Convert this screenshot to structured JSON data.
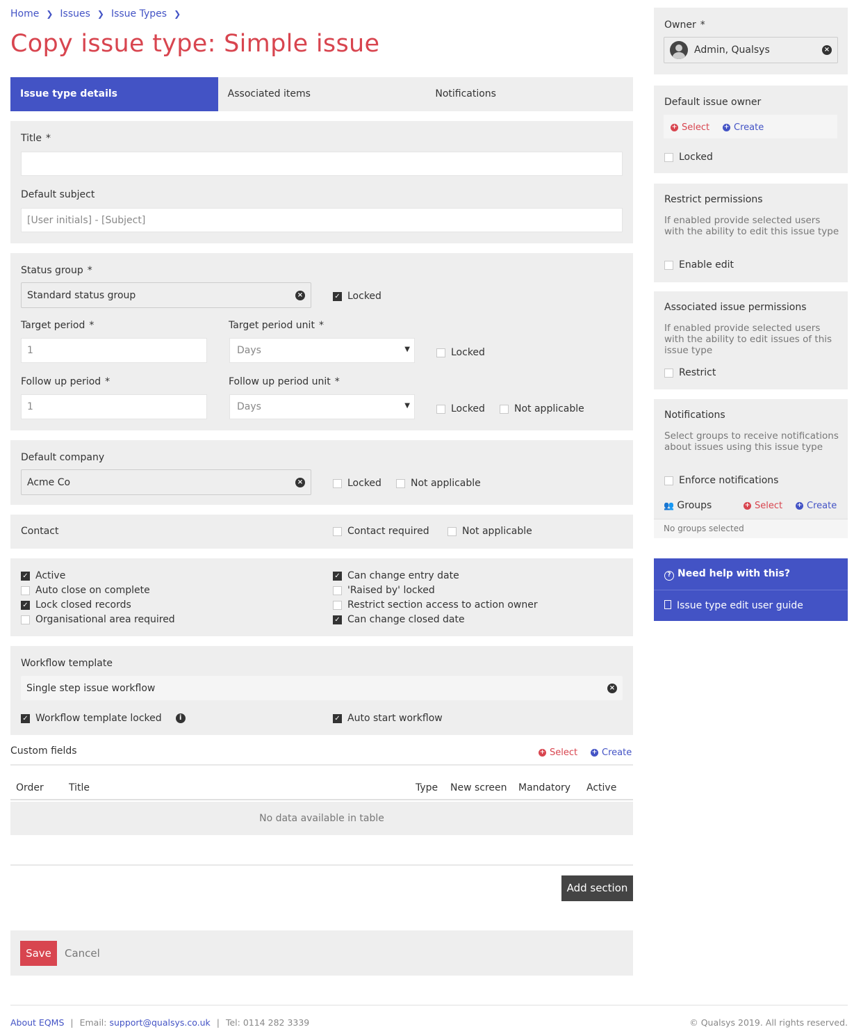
{
  "breadcrumb": [
    "Home",
    "Issues",
    "Issue Types"
  ],
  "page_title": "Copy issue type: Simple issue",
  "tabs": [
    "Issue type details",
    "Associated items",
    "Notifications"
  ],
  "form": {
    "title_label": "Title",
    "title_value": "",
    "default_subject_label": "Default subject",
    "default_subject_placeholder": "[User initials] - [Subject]",
    "status_group_label": "Status group",
    "status_group_value": "Standard status group",
    "status_locked_label": "Locked",
    "target_period_label": "Target period",
    "target_period_value": "1",
    "target_period_unit_label": "Target period unit",
    "target_period_unit_value": "Days",
    "target_locked_label": "Locked",
    "follow_up_period_label": "Follow up period",
    "follow_up_period_value": "1",
    "follow_up_period_unit_label": "Follow up period unit",
    "follow_up_period_unit_value": "Days",
    "follow_locked_label": "Locked",
    "follow_na_label": "Not applicable",
    "default_company_label": "Default company",
    "default_company_value": "Acme Co",
    "company_locked_label": "Locked",
    "company_na_label": "Not applicable",
    "contact_label": "Contact",
    "contact_required_label": "Contact required",
    "contact_na_label": "Not applicable",
    "options_left": [
      {
        "label": "Active",
        "checked": true
      },
      {
        "label": "Auto close on complete",
        "checked": false
      },
      {
        "label": "Lock closed records",
        "checked": true
      },
      {
        "label": "Organisational area required",
        "checked": false
      }
    ],
    "options_right": [
      {
        "label": "Can change entry date",
        "checked": true
      },
      {
        "label": "'Raised by' locked",
        "checked": false
      },
      {
        "label": "Restrict section access to action owner",
        "checked": false
      },
      {
        "label": "Can change closed date",
        "checked": true
      }
    ],
    "workflow_template_label": "Workflow template",
    "workflow_template_value": "Single step issue workflow",
    "workflow_locked_label": "Workflow template locked",
    "auto_start_label": "Auto start workflow"
  },
  "custom_fields": {
    "title": "Custom fields",
    "select_label": "Select",
    "create_label": "Create",
    "columns": [
      "Order",
      "Title",
      "Type",
      "New screen",
      "Mandatory",
      "Active"
    ],
    "empty_text": "No data available in table"
  },
  "add_section_label": "Add section",
  "save_label": "Save",
  "cancel_label": "Cancel",
  "sidebar": {
    "owner_label": "Owner",
    "owner_value": "Admin, Qualsys",
    "default_issue_owner_label": "Default issue owner",
    "select_label": "Select",
    "create_label": "Create",
    "locked_label": "Locked",
    "restrict_permissions_label": "Restrict permissions",
    "restrict_permissions_desc": "If enabled provide selected users with the ability to edit this issue type",
    "enable_edit_label": "Enable edit",
    "associated_issue_permissions_label": "Associated issue permissions",
    "associated_issue_permissions_desc": "If enabled provide selected users with the ability to edit issues of this issue type",
    "restrict_label": "Restrict",
    "notifications_label": "Notifications",
    "notifications_desc": "Select groups to receive notifications about issues using this issue type",
    "enforce_notifications_label": "Enforce notifications",
    "groups_label": "Groups",
    "groups_select": "Select",
    "groups_create": "Create",
    "no_groups_text": "No groups selected",
    "help_title": "Need help with this?",
    "help_link": "Issue type edit user guide"
  },
  "footer": {
    "about": "About EQMS",
    "email_label": "Email:",
    "email": "support@qualsys.co.uk",
    "tel": "Tel: 0114 282 3339",
    "copyright": "© Qualsys 2019. All rights reserved."
  },
  "colors": {
    "accent": "#4353c5",
    "brand_red": "#d8454f",
    "panel": "#eeeeee"
  }
}
